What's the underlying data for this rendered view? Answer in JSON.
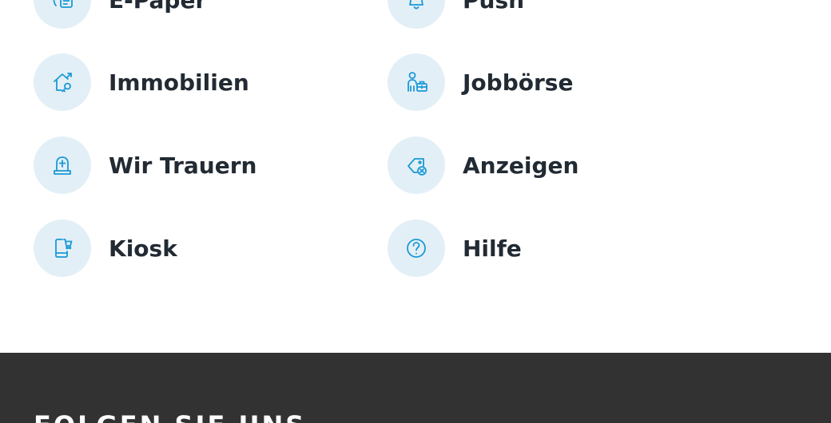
{
  "services": {
    "epaper": {
      "label": "E-Paper",
      "icon": "e-paper-icon"
    },
    "push": {
      "label": "Push",
      "icon": "bell-icon"
    },
    "immobilien": {
      "label": "Immobilien",
      "icon": "house-key-icon"
    },
    "jobboerse": {
      "label": "Jobbörse",
      "icon": "person-briefcase-icon"
    },
    "trauern": {
      "label": "Wir Trauern",
      "icon": "gravestone-icon"
    },
    "anzeigen": {
      "label": "Anzeigen",
      "icon": "price-tag-icon"
    },
    "kiosk": {
      "label": "Kiosk",
      "icon": "phone-cart-icon"
    },
    "hilfe": {
      "label": "Hilfe",
      "icon": "question-icon"
    }
  },
  "footer": {
    "title": "FOLGEN SIE UNS"
  },
  "colors": {
    "icon_stroke": "#1a9ad6",
    "icon_background": "#e3eff6",
    "label_text": "#222a33",
    "footer_background": "#323232",
    "footer_text": "#ffffff"
  }
}
